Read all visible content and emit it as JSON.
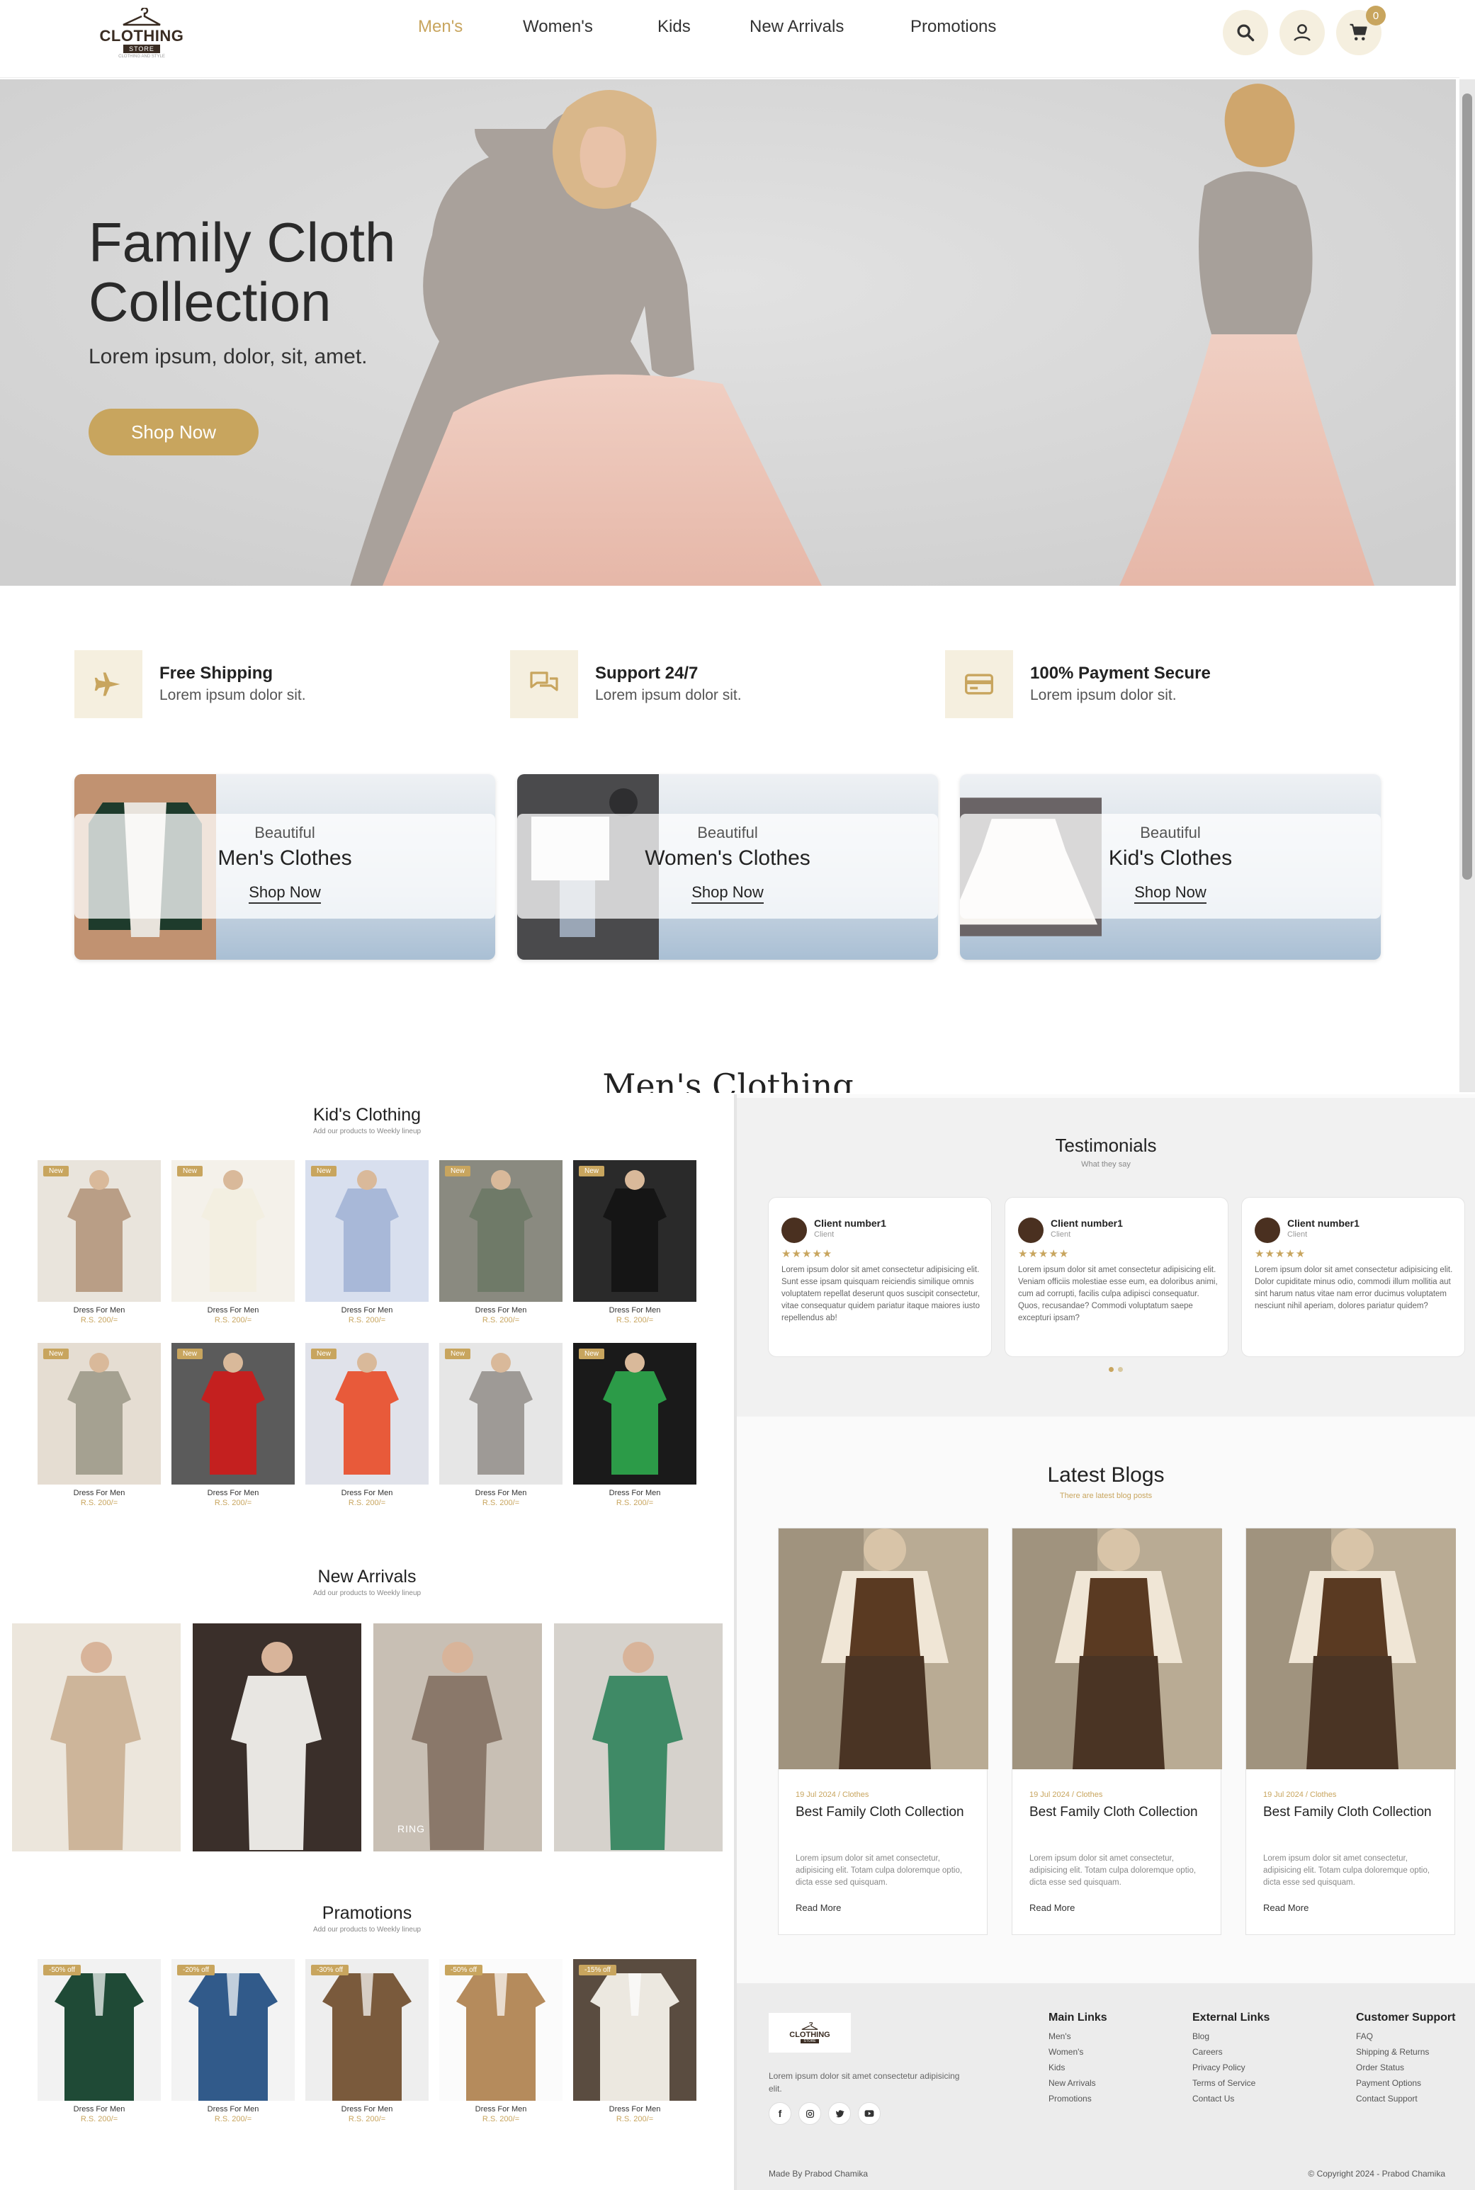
{
  "brand": {
    "name": "CLOTHING",
    "sub": "STORE",
    "tagline": "CLOTHING AND STYLE"
  },
  "nav": {
    "items": [
      "Men's",
      "Women's",
      "Kids",
      "New Arrivals",
      "Promotions"
    ],
    "active": "Men's",
    "cart_count": "0"
  },
  "hero": {
    "title": "Family Cloth\nCollection",
    "subtitle": "Lorem ipsum, dolor, sit, amet.",
    "button": "Shop Now"
  },
  "features": [
    {
      "title": "Free Shipping",
      "desc": "Lorem ipsum dolor sit.",
      "icon": "plane-icon"
    },
    {
      "title": "Support 24/7",
      "desc": "Lorem ipsum dolor sit.",
      "icon": "chat-icon"
    },
    {
      "title": "100% Payment Secure",
      "desc": "Lorem ipsum dolor sit.",
      "icon": "credit-card-icon"
    }
  ],
  "categories": [
    {
      "sub": "Beautiful",
      "title": "Men's Clothes",
      "link": "Shop Now"
    },
    {
      "sub": "Beautiful",
      "title": "Women's Clothes",
      "link": "Shop Now"
    },
    {
      "sub": "Beautiful",
      "title": "Kid's Clothes",
      "link": "Shop Now"
    }
  ],
  "mens_heading": "Men's Clothing",
  "kids": {
    "title": "Kid's Clothing",
    "subtitle": "Add our products to Weekly lineup",
    "badge": "New",
    "item_name": "Dress For Men",
    "item_price": "R.S. 200/="
  },
  "arrivals": {
    "title": "New Arrivals",
    "subtitle": "Add our products to Weekly lineup",
    "watermark": "RING"
  },
  "promotions": {
    "title": "Pramotions",
    "subtitle": "Add our products to Weekly lineup",
    "badges": [
      "-50% off",
      "-20% off",
      "-30% off",
      "-50% off",
      "-15% off"
    ],
    "item_name": "Dress For Men",
    "item_price": "R.S. 200/="
  },
  "testimonials": {
    "title": "Testimonials",
    "subtitle": "What they say",
    "cards": [
      {
        "name": "Client number1",
        "role": "Client",
        "stars": "★★★★★",
        "text": "Lorem ipsum dolor sit amet consectetur adipisicing elit. Sunt esse ipsam quisquam reiciendis similique omnis voluptatem repellat deserunt quos suscipit consectetur, vitae consequatur quidem pariatur itaque maiores iusto repellendus ab!"
      },
      {
        "name": "Client number1",
        "role": "Client",
        "stars": "★★★★★",
        "text": "Lorem ipsum dolor sit amet consectetur adipisicing elit. Veniam officiis molestiae esse eum, ea doloribus animi, cum ad corrupti, facilis culpa adipisci consequatur. Quos, recusandae? Commodi voluptatum saepe excepturi ipsam?"
      },
      {
        "name": "Client number1",
        "role": "Client",
        "stars": "★★★★★",
        "text": "Lorem ipsum dolor sit amet consectetur adipisicing elit. Dolor cupiditate minus odio, commodi illum mollitia aut sint harum natus vitae nam error ducimus voluptatem nesciunt nihil aperiam, dolores pariatur quidem?"
      }
    ]
  },
  "blogs": {
    "title": "Latest Blogs",
    "subtitle": "There are latest blog posts",
    "meta": "19 Jul 2024 / Clothes",
    "post_title": "Best Family Cloth Collection",
    "desc": "Lorem ipsum dolor sit amet consectetur, adipisicing elit. Totam culpa doloremque optio, dicta esse sed quisquam.",
    "more": "Read More"
  },
  "footer": {
    "about": "Lorem ipsum dolor sit amet consectetur adipisicing elit.",
    "main_title": "Main Links",
    "main_links": [
      "Men's",
      "Women's",
      "Kids",
      "New Arrivals",
      "Promotions"
    ],
    "external_title": "External Links",
    "external_links": [
      "Blog",
      "Careers",
      "Privacy Policy",
      "Terms of Service",
      "Contact Us"
    ],
    "support_title": "Customer Support",
    "support_links": [
      "FAQ",
      "Shipping & Returns",
      "Order Status",
      "Payment Options",
      "Contact Support"
    ],
    "made_by": "Made By Prabod Chamika",
    "copyright": "© Copyright 2024 - Prabod Chamika"
  },
  "colors": {
    "accent": "#c8a55e",
    "accent_light": "#f5efdf"
  }
}
